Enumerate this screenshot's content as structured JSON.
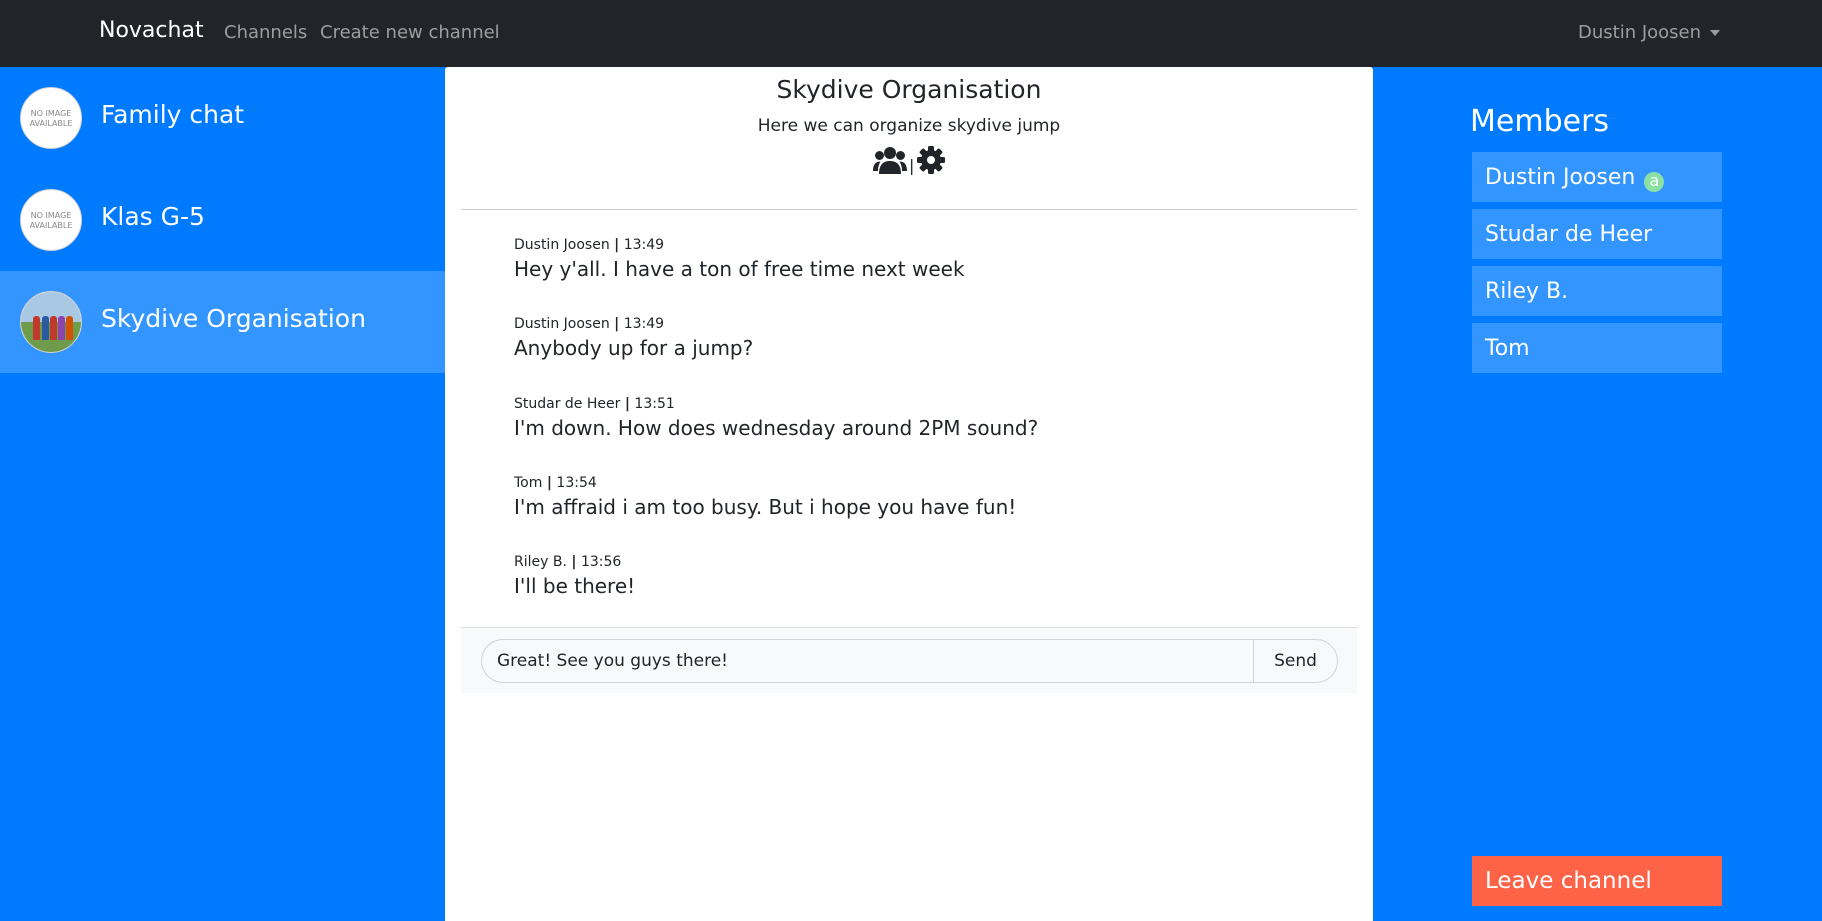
{
  "navbar": {
    "brand": "Novachat",
    "links": [
      "Channels",
      "Create new channel"
    ],
    "user": "Dustin Joosen"
  },
  "sidebar": {
    "channels": [
      {
        "name": "Family chat",
        "avatar": "NO IMAGE AVAILABLE",
        "active": false
      },
      {
        "name": "Klas G-5",
        "avatar": "NO IMAGE AVAILABLE",
        "active": false
      },
      {
        "name": "Skydive Organisation",
        "avatar": "group-photo",
        "active": true
      }
    ]
  },
  "channel": {
    "title": "Skydive Organisation",
    "description": "Here we can organize skydive jump",
    "icons": [
      "users-icon",
      "gear-icon"
    ],
    "icon_separator": "|"
  },
  "messages": [
    {
      "author": "Dustin Joosen",
      "time": "13:49",
      "text": "Hey y'all. I have a ton of free time next week"
    },
    {
      "author": "Dustin Joosen",
      "time": "13:49",
      "text": "Anybody up for a jump?"
    },
    {
      "author": "Studar de Heer",
      "time": "13:51",
      "text": "I'm down. How does wednesday around 2PM sound?"
    },
    {
      "author": "Tom",
      "time": "13:54",
      "text": "I'm affraid i am too busy. But i hope you have fun!"
    },
    {
      "author": "Riley B.",
      "time": "13:56",
      "text": "I'll be there!"
    }
  ],
  "meta_separator": "|",
  "compose": {
    "value": "Great! See you guys there!",
    "send_label": "Send"
  },
  "members": {
    "title": "Members",
    "list": [
      {
        "name": "Dustin Joosen",
        "badge": "a"
      },
      {
        "name": "Studar de Heer"
      },
      {
        "name": "Riley B."
      },
      {
        "name": "Tom"
      }
    ],
    "leave_label": "Leave channel"
  },
  "colors": {
    "primary": "#007bff",
    "navbar": "#212529",
    "leave": "#ff6347",
    "admin_badge": "#8be0a4"
  }
}
